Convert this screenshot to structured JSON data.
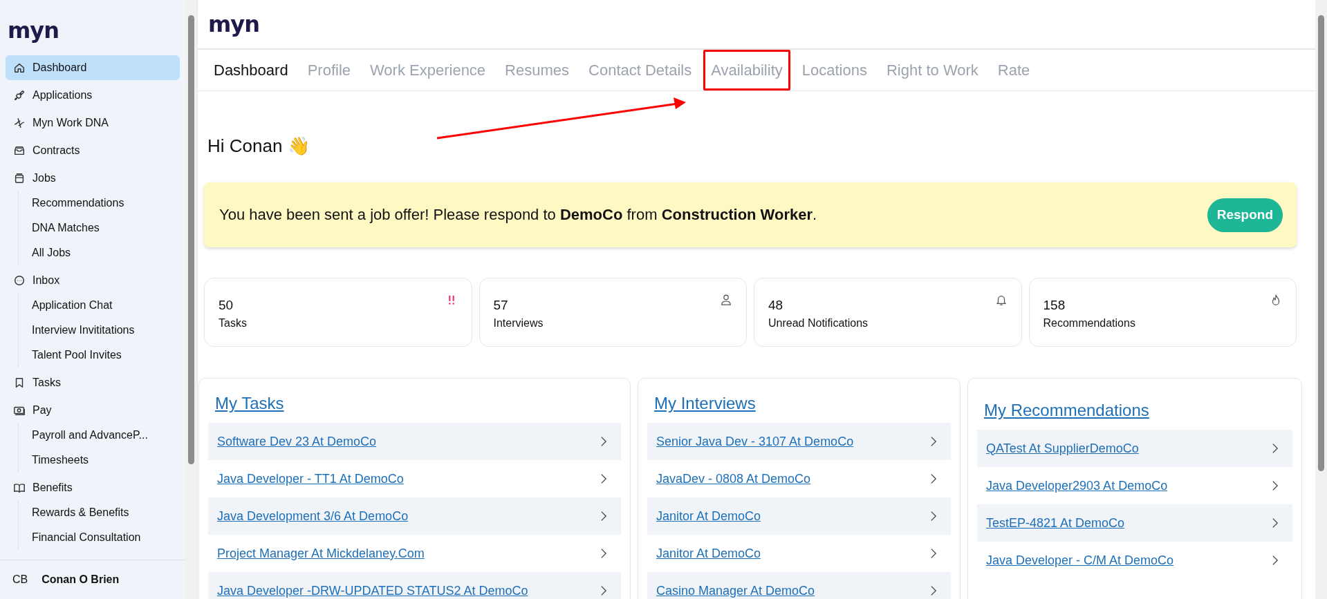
{
  "sidebar": {
    "logo": "myn",
    "items": [
      {
        "label": "Dashboard",
        "selected": true
      },
      {
        "label": "Applications",
        "selected": false
      },
      {
        "label": "Myn Work DNA",
        "selected": false
      },
      {
        "label": "Contracts",
        "selected": false
      },
      {
        "label": "Jobs",
        "selected": false,
        "children": [
          {
            "label": "Recommendations",
            "selected": false
          },
          {
            "label": "DNA Matches",
            "selected": false
          },
          {
            "label": "All Jobs",
            "selected": false
          }
        ]
      },
      {
        "label": "Inbox",
        "selected": false,
        "children": [
          {
            "label": "Application Chat",
            "selected": false
          },
          {
            "label": "Interview Invititations",
            "selected": false
          },
          {
            "label": "Talent Pool Invites",
            "selected": false
          }
        ]
      },
      {
        "label": "Tasks",
        "selected": false
      },
      {
        "label": "Pay",
        "selected": false,
        "children": [
          {
            "label": "Payroll and AdvanceP...",
            "selected": false
          },
          {
            "label": "Timesheets",
            "selected": false
          }
        ]
      },
      {
        "label": "Benefits",
        "selected": false,
        "children": [
          {
            "label": "Rewards & Benefits",
            "selected": false
          },
          {
            "label": "Financial Consultation",
            "selected": false
          }
        ]
      }
    ],
    "user": {
      "initials": "CB",
      "name": "Conan O Brien"
    }
  },
  "header": {
    "logo": "myn"
  },
  "tabs": [
    {
      "label": "Dashboard",
      "selected": true,
      "highlighted": false
    },
    {
      "label": "Profile",
      "selected": false,
      "highlighted": false
    },
    {
      "label": "Work Experience",
      "selected": false,
      "highlighted": false
    },
    {
      "label": "Resumes",
      "selected": false,
      "highlighted": false
    },
    {
      "label": "Contact Details",
      "selected": false,
      "highlighted": false
    },
    {
      "label": "Availability",
      "selected": false,
      "highlighted": true
    },
    {
      "label": "Locations",
      "selected": false,
      "highlighted": false
    },
    {
      "label": "Right to Work",
      "selected": false,
      "highlighted": false
    },
    {
      "label": "Rate",
      "selected": false,
      "highlighted": false
    }
  ],
  "greeting": "Hi Conan 👋",
  "banner": {
    "message": "You have been sent a job offer! Please respond to **DemoCo** from **Construction Worker**.",
    "button": "Respond"
  },
  "stats": [
    {
      "value": "50",
      "label": "Tasks"
    },
    {
      "value": "57",
      "label": "Interviews"
    },
    {
      "value": "48",
      "label": "Unread Notifications"
    },
    {
      "value": "158",
      "label": "Recommendations"
    }
  ],
  "panels": [
    {
      "title": "My Tasks",
      "items": [
        "Software Dev 23 At DemoCo",
        "Java Developer - TT1 At DemoCo",
        "Java Development 3/6 At DemoCo",
        "Project Manager At Mickdelaney.Com",
        "Java Developer -DRW-UPDATED STATUS2 At DemoCo"
      ]
    },
    {
      "title": "My Interviews",
      "items": [
        "Senior Java Dev - 3107 At DemoCo",
        "JavaDev - 0808 At DemoCo",
        "Janitor At DemoCo",
        "Janitor At DemoCo",
        "Casino Manager At DemoCo"
      ]
    },
    {
      "title": "My Recommendations",
      "items": [
        "QATest At SupplierDemoCo",
        "Java Developer2903 At DemoCo",
        "TestEP-4821 At DemoCo",
        "Java Developer - C/M At DemoCo"
      ]
    }
  ]
}
